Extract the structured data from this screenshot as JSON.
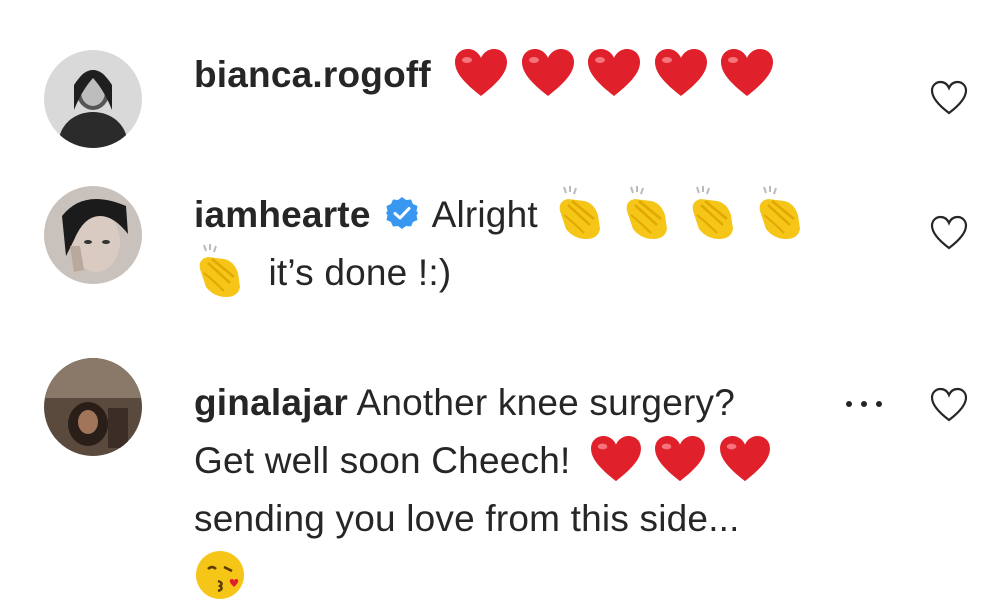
{
  "comments": [
    {
      "username": "bianca.rogoff",
      "verified": false,
      "lines": [
        {
          "text": "",
          "emoji": [
            "heart",
            "heart",
            "heart",
            "heart",
            "heart"
          ]
        }
      ]
    },
    {
      "username": "iamhearte",
      "verified": true,
      "lines": [
        {
          "text": "Alright",
          "emoji": [
            "clap",
            "clap",
            "clap",
            "clap"
          ]
        },
        {
          "text": "it’s done !:)",
          "emoji_before": [
            "clap"
          ]
        }
      ]
    },
    {
      "username": "ginalajar",
      "verified": false,
      "line1_text": "Another knee surgery?",
      "line2_text": "Get well soon Cheech!",
      "line2_emoji": [
        "heart",
        "heart",
        "heart"
      ],
      "line3_text": "sending you love from this side...",
      "line4_emoji": [
        "kiss"
      ]
    }
  ],
  "colors": {
    "text": "#262626",
    "heart_emoji": "#e0202b",
    "clap_emoji": "#f5c518",
    "verified_badge": "#3897f0",
    "like_outline": "#262626"
  },
  "icons": {
    "like": "heart-outline-icon",
    "more": "more-options-icon",
    "verified": "verified-badge-icon"
  }
}
